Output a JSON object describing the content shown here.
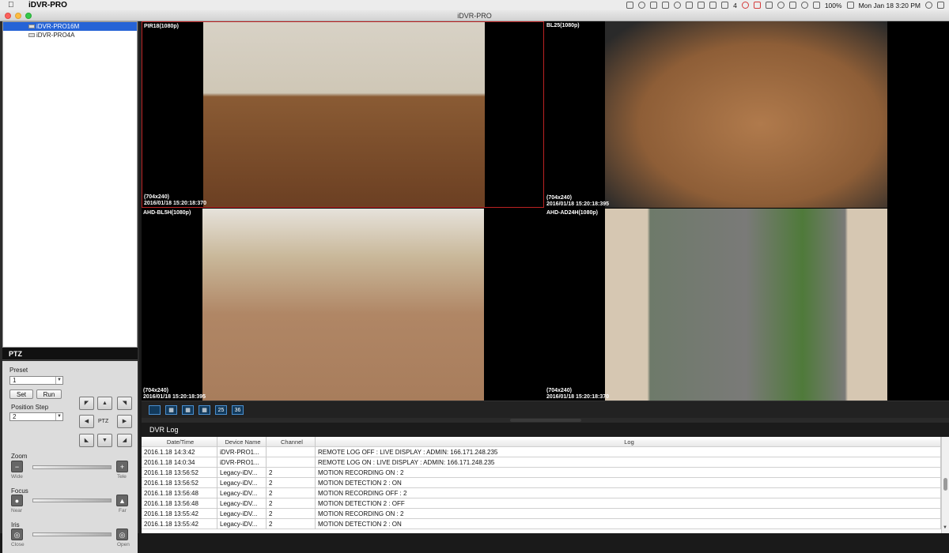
{
  "menubar": {
    "app_name": "iDVR-PRO",
    "battery": "100%",
    "datetime": "Mon Jan 18  3:20 PM",
    "notif_count": "4"
  },
  "window": {
    "title": "iDVR-PRO"
  },
  "tree": {
    "items": [
      {
        "label": "iDVR-PRO16M",
        "selected": true
      },
      {
        "label": "iDVR-PRO4A",
        "selected": false
      }
    ]
  },
  "ptz": {
    "title": "PTZ",
    "preset_label": "Preset",
    "preset_value": "1",
    "set_label": "Set",
    "run_label": "Run",
    "pos_step_label": "Position Step",
    "pos_step_value": "2",
    "center_label": "PTZ",
    "zoom_label": "Zoom",
    "zoom_min": "Wide",
    "zoom_max": "Tele",
    "focus_label": "Focus",
    "focus_min": "Near",
    "focus_max": "Far",
    "iris_label": "Iris",
    "iris_min": "Close",
    "iris_max": "Open"
  },
  "cameras": [
    {
      "name": "PIR18(1080p)",
      "res": "(704x240)",
      "time": "2016/01/18 15:20:18:370"
    },
    {
      "name": "BL25(1080p)",
      "res": "(704x240)",
      "time": "2016/01/18 15:20:18:395"
    },
    {
      "name": "AHD-BL5H(1080p)",
      "res": "(704x240)",
      "time": "2016/01/18 15:20:18:395"
    },
    {
      "name": "AHD-AD24H(1080p)",
      "res": "(704x240)",
      "time": "2016/01/18 15:20:18:370"
    }
  ],
  "layout_buttons": [
    "",
    "",
    "",
    "",
    "25",
    "36"
  ],
  "log": {
    "title": "DVR Log",
    "headers": [
      "Date/Time",
      "Device Name",
      "Channel",
      "Log"
    ],
    "rows": [
      [
        "2016.1.18 14:3:42",
        "iDVR-PRO1...",
        "",
        "REMOTE LOG OFF : LIVE DISPLAY : ADMIN: 166.171.248.235"
      ],
      [
        "2016.1.18 14:0:34",
        "iDVR-PRO1...",
        "",
        "REMOTE LOG ON : LIVE DISPLAY : ADMIN: 166.171.248.235"
      ],
      [
        "2016.1.18 13:56:52",
        "Legacy-iDV...",
        "2",
        "MOTION RECORDING ON : 2"
      ],
      [
        "2016.1.18 13:56:52",
        "Legacy-iDV...",
        "2",
        "MOTION DETECTION 2 : ON"
      ],
      [
        "2016.1.18 13:56:48",
        "Legacy-iDV...",
        "2",
        "MOTION RECORDING OFF : 2"
      ],
      [
        "2016.1.18 13:56:48",
        "Legacy-iDV...",
        "2",
        "MOTION DETECTION 2 : OFF"
      ],
      [
        "2016.1.18 13:55:42",
        "Legacy-iDV...",
        "2",
        "MOTION RECORDING ON : 2"
      ],
      [
        "2016.1.18 13:55:42",
        "Legacy-iDV...",
        "2",
        "MOTION DETECTION 2 : ON"
      ]
    ]
  }
}
